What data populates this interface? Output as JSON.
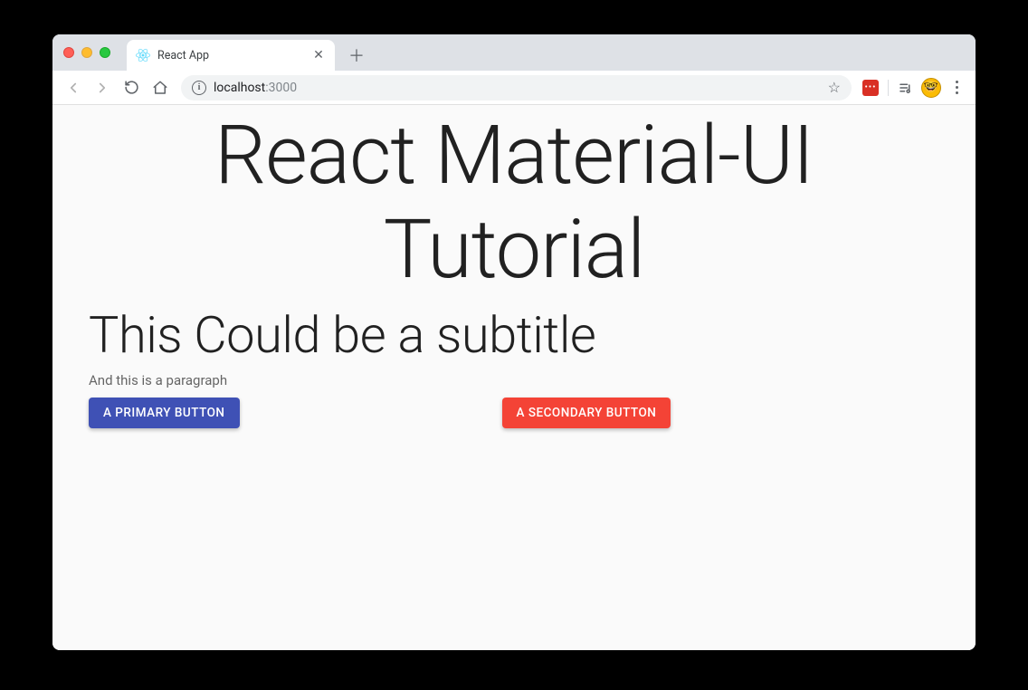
{
  "browser": {
    "tab_title": "React App",
    "url_host": "localhost",
    "url_port": ":3000"
  },
  "page": {
    "heading": "React Material-UI Tutorial",
    "subtitle": "This Could be a subtitle",
    "paragraph": "And this is a paragraph",
    "primary_button": "A Primary Button",
    "secondary_button": "A Secondary Button"
  },
  "colors": {
    "primary": "#3f51b5",
    "secondary": "#f44336"
  }
}
